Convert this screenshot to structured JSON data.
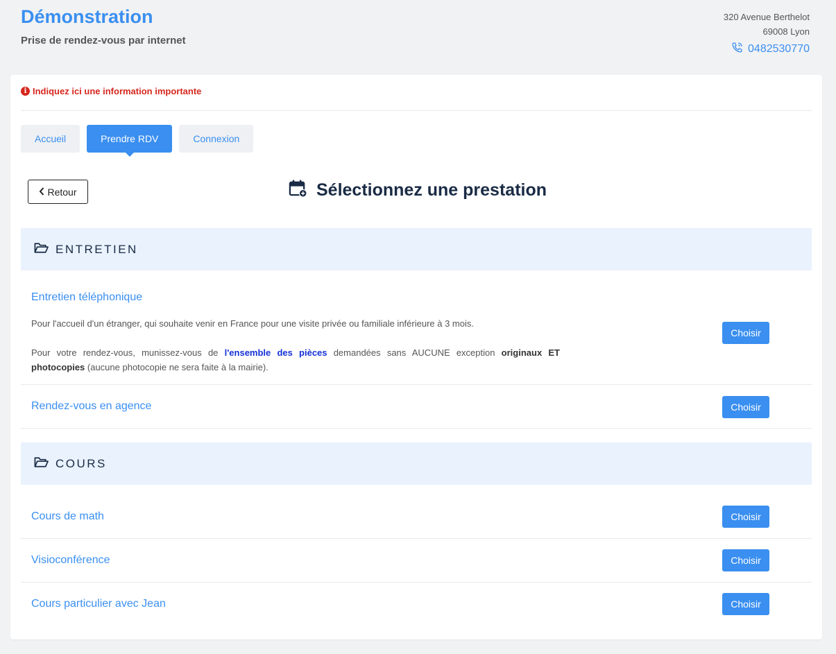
{
  "header": {
    "title": "Démonstration",
    "subtitle": "Prise de rendez-vous par internet",
    "address_line1": "320 Avenue Berthelot",
    "address_line2": "69008 Lyon",
    "phone": "0482530770"
  },
  "alert": {
    "text": "Indiquez ici une information importante"
  },
  "tabs": [
    {
      "label": "Accueil"
    },
    {
      "label": "Prendre RDV"
    },
    {
      "label": "Connexion"
    }
  ],
  "back_label": "Retour",
  "page_heading": "Sélectionnez une prestation",
  "categories": [
    {
      "label": "ENTRETIEN"
    },
    {
      "label": "COURS"
    }
  ],
  "services": [
    {
      "name": "Entretien téléphonique",
      "button": "Choisir",
      "desc_p1": "Pour l'accueil d'un étranger, qui souhaite venir en France pour une visite privée ou familiale inférieure à 3 mois.",
      "desc_p2_a": "Pour votre rendez-vous, munissez-vous de ",
      "desc_p2_link": "l'ensemble des pièces",
      "desc_p2_b": " demandées sans AUCUNE exception ",
      "desc_p2_bold": "originaux ET photocopies",
      "desc_p2_c": " (aucune photocopie ne sera faite à la mairie)."
    },
    {
      "name": "Rendez-vous en agence",
      "button": "Choisir"
    },
    {
      "name": "Cours de math",
      "button": "Choisir"
    },
    {
      "name": "Visioconférence",
      "button": "Choisir"
    },
    {
      "name": "Cours particulier avec Jean",
      "button": "Choisir"
    }
  ],
  "colors": {
    "accent": "#3a8ff0",
    "alert": "#d6271d",
    "category_bg": "#e9f2fd",
    "page_bg": "#f1f2f4",
    "heading": "#1a2b45"
  },
  "icons": {
    "phone": "phone-icon",
    "alert": "info-circle-icon",
    "back": "chevron-left-icon",
    "heading": "calendar-plus-icon",
    "category": "folder-open-icon"
  }
}
